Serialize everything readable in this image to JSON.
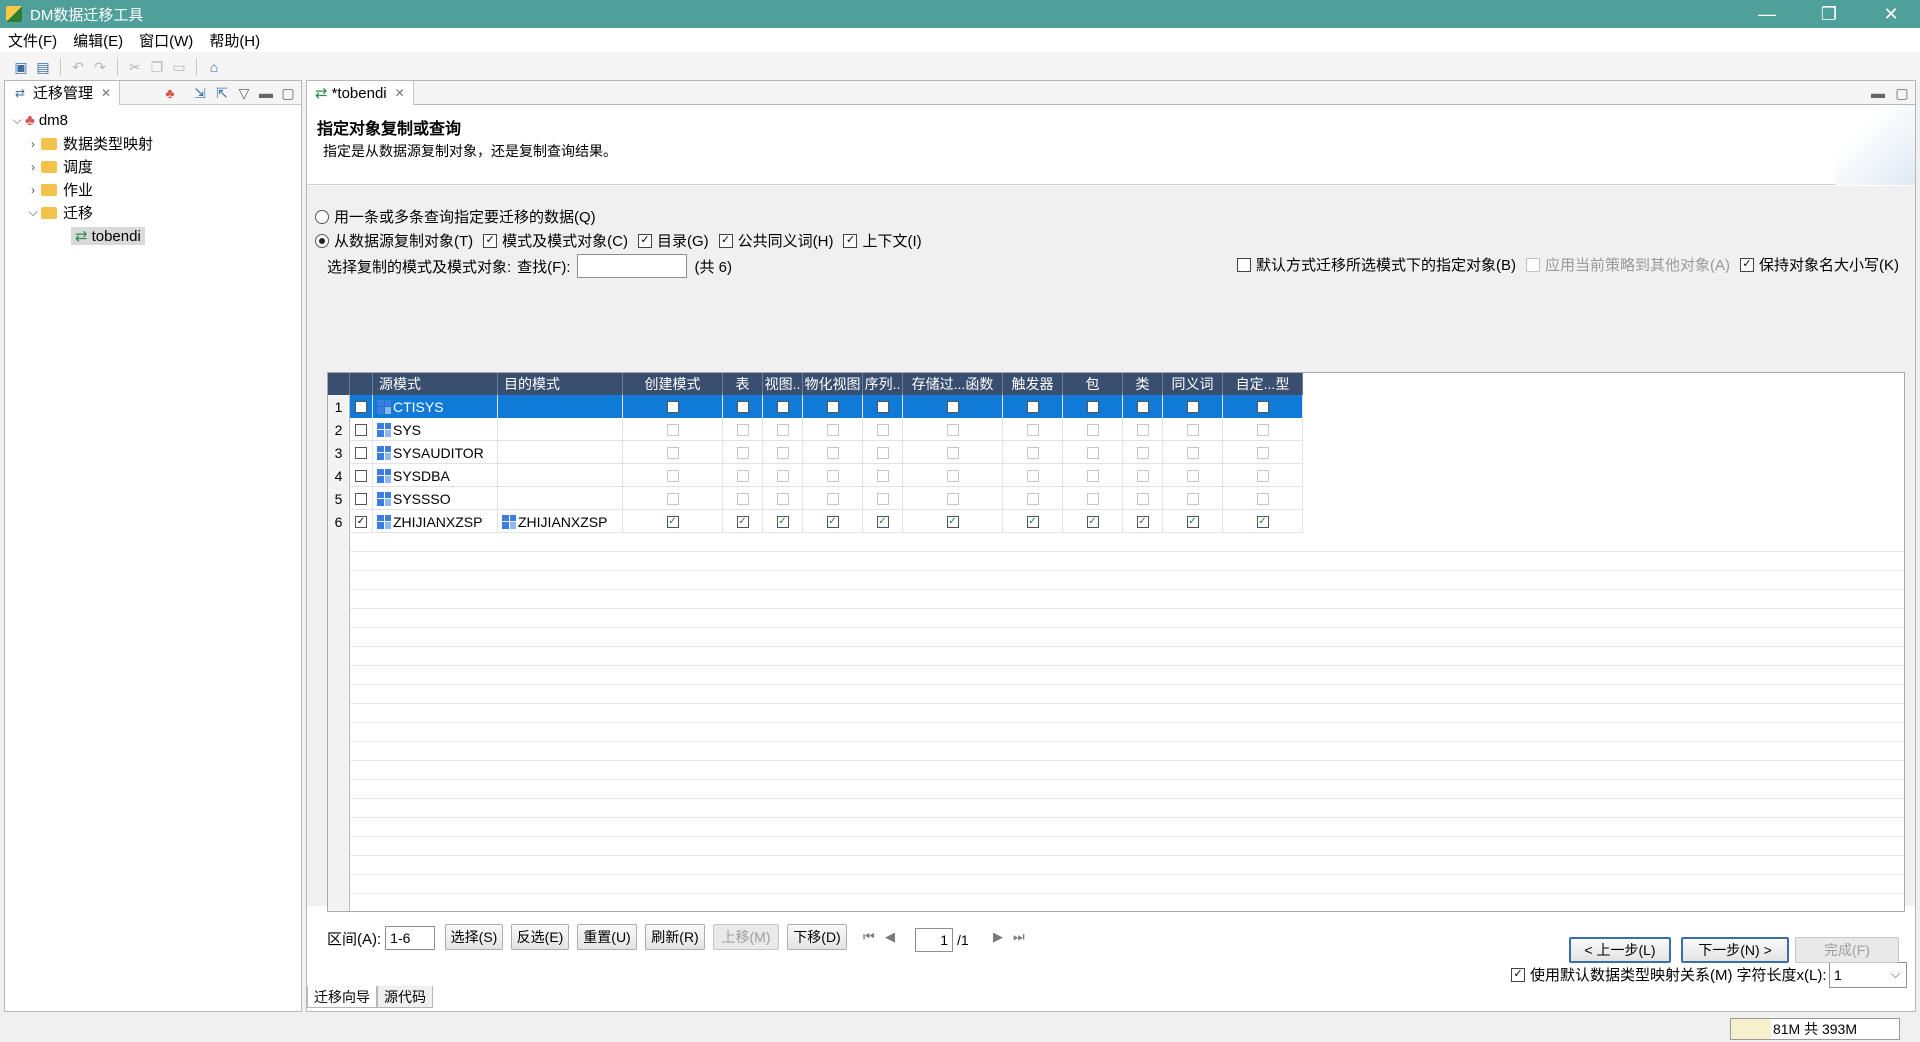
{
  "window": {
    "title": "DM数据迁移工具",
    "controls": [
      "—",
      "❐",
      "✕"
    ]
  },
  "menu": [
    "文件(F)",
    "编辑(E)",
    "窗口(W)",
    "帮助(H)"
  ],
  "left_panel": {
    "tab_label": "迁移管理",
    "tree": {
      "root": "dm8",
      "items": [
        "数据类型映射",
        "调度",
        "作业",
        "迁移"
      ],
      "migration_child": "tobendi"
    }
  },
  "editor": {
    "tab_label": "*tobendi",
    "header": {
      "title": "指定对象复制或查询",
      "description": "指定是从数据源复制对象，还是复制查询结果。"
    },
    "options": {
      "query_radio": "用一条或多条查询指定要迁移的数据(Q)",
      "copy_radio": "从数据源复制对象(T)",
      "schema_objects": "模式及模式对象(C)",
      "catalog": "目录(G)",
      "public_synonyms": "公共同义词(H)",
      "context": "上下文(I)"
    },
    "select_label": "选择复制的模式及模式对象:",
    "find_label": "查找(F):",
    "find_value": "",
    "count_label": "(共 6)",
    "right_options": {
      "default_migrate": "默认方式迁移所选模式下的指定对象(B)",
      "apply_policy": "应用当前策略到其他对象(A)",
      "keep_case": "保持对象名大小写(K)"
    },
    "grid": {
      "columns": [
        "源模式",
        "目的模式",
        "创建模式",
        "表",
        "视图..",
        "物化视图",
        "序列..",
        "存储过...函数",
        "触发器",
        "包",
        "类",
        "同义词",
        "自定...型"
      ],
      "rows": [
        {
          "num": "1",
          "source": "CTISYS",
          "target": "",
          "checked": false,
          "flags": "empty"
        },
        {
          "num": "2",
          "source": "SYS",
          "target": "",
          "checked": false,
          "flags": "disabled"
        },
        {
          "num": "3",
          "source": "SYSAUDITOR",
          "target": "",
          "checked": false,
          "flags": "disabled"
        },
        {
          "num": "4",
          "source": "SYSDBA",
          "target": "",
          "checked": false,
          "flags": "disabled"
        },
        {
          "num": "5",
          "source": "SYSSSO",
          "target": "",
          "checked": false,
          "flags": "disabled"
        },
        {
          "num": "6",
          "source": "ZHIJIANXZSP",
          "target": "ZHIJIANXZSP",
          "checked": true,
          "flags": "checked"
        }
      ]
    },
    "range_label": "区间(A):",
    "range_value": "1-6",
    "buttons": {
      "select": "选择(S)",
      "invert": "反选(E)",
      "reset": "重置(U)",
      "refresh": "刷新(R)",
      "move_up": "上移(M)",
      "move_down": "下移(D)"
    },
    "pager": {
      "page": "1",
      "total": "/1"
    },
    "mapping_option": "使用默认数据类型映射关系(M)",
    "char_length_label": "字符长度x(L):",
    "char_length_value": "1",
    "wizard_buttons": {
      "back": "< 上一步(L)",
      "next": "下一步(N) >",
      "finish": "完成(F)"
    },
    "bottom_tabs": [
      "迁移向导",
      "源代码"
    ]
  },
  "status": {
    "memory": "81M 共 393M"
  }
}
